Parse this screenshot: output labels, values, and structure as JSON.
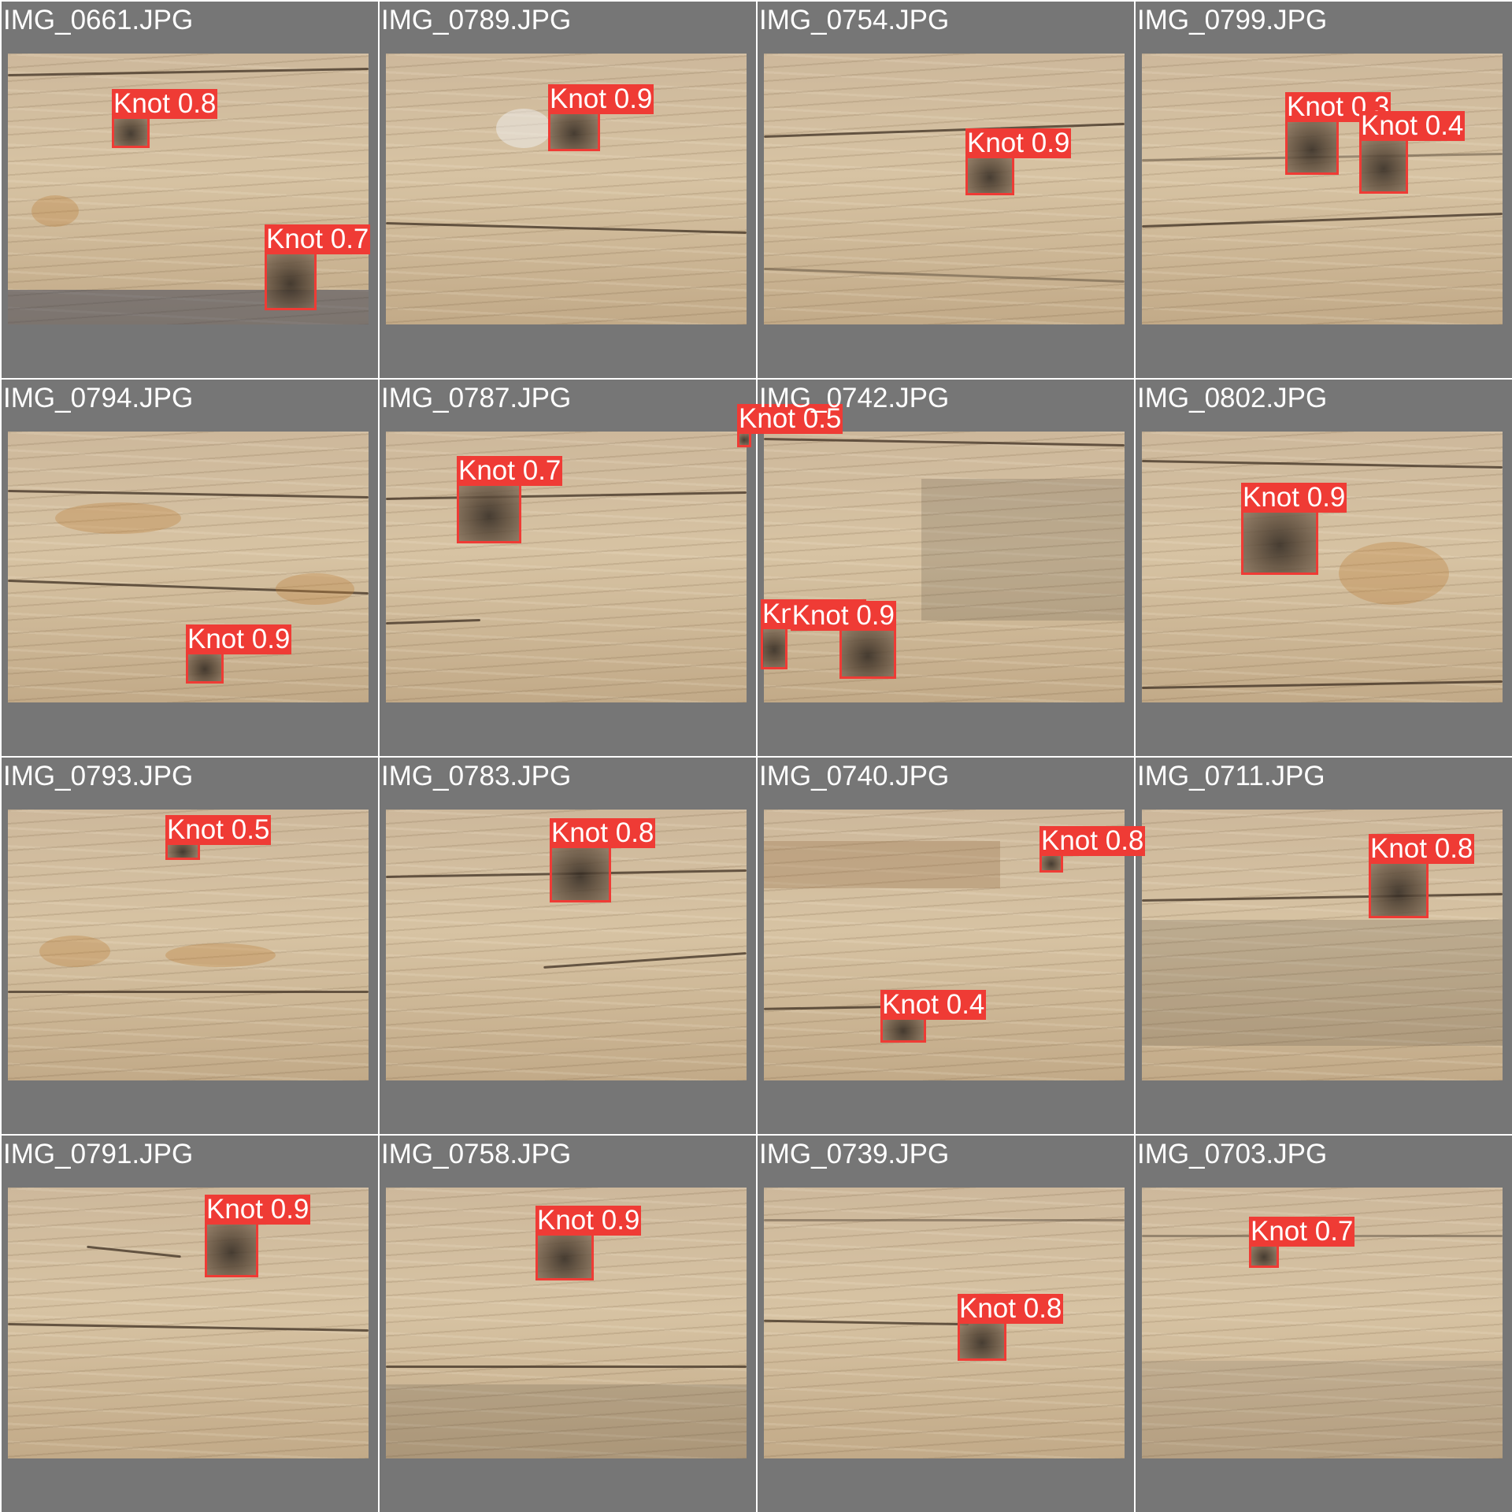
{
  "colors": {
    "tile_background": "#767676",
    "box_color": "#ef3b35",
    "label_text": "#ffffff"
  },
  "tiles": [
    {
      "filename": "IMG_0661.JPG",
      "detections": [
        {
          "label": "Knot 0.8"
        },
        {
          "label": "Knot 0.7"
        }
      ]
    },
    {
      "filename": "IMG_0789.JPG",
      "detections": [
        {
          "label": "Knot 0.9"
        }
      ]
    },
    {
      "filename": "IMG_0754.JPG",
      "detections": [
        {
          "label": "Knot 0.9"
        }
      ]
    },
    {
      "filename": "IMG_0799.JPG",
      "detections": [
        {
          "label": "Knot 0.3"
        },
        {
          "label": "Knot 0.4"
        }
      ]
    },
    {
      "filename": "IMG_0794.JPG",
      "detections": [
        {
          "label": "Knot 0.9"
        }
      ]
    },
    {
      "filename": "IMG_0787.JPG",
      "detections": [
        {
          "label": "Knot 0.7"
        },
        {
          "label": "Knot 0.5"
        }
      ]
    },
    {
      "filename": "IMG_0742.JPG",
      "detections": [
        {
          "label": "Knot 0.4"
        },
        {
          "label": "Knot 0.9"
        }
      ]
    },
    {
      "filename": "IMG_0802.JPG",
      "detections": [
        {
          "label": "Knot 0.9"
        }
      ]
    },
    {
      "filename": "IMG_0793.JPG",
      "detections": [
        {
          "label": "Knot 0.5"
        }
      ]
    },
    {
      "filename": "IMG_0783.JPG",
      "detections": [
        {
          "label": "Knot 0.8"
        }
      ]
    },
    {
      "filename": "IMG_0740.JPG",
      "detections": [
        {
          "label": "Knot 0.8"
        },
        {
          "label": "Knot 0.4"
        }
      ]
    },
    {
      "filename": "IMG_0711.JPG",
      "detections": [
        {
          "label": "Knot 0.8"
        }
      ]
    },
    {
      "filename": "IMG_0791.JPG",
      "detections": [
        {
          "label": "Knot 0.9"
        }
      ]
    },
    {
      "filename": "IMG_0758.JPG",
      "detections": [
        {
          "label": "Knot 0.9"
        }
      ]
    },
    {
      "filename": "IMG_0739.JPG",
      "detections": [
        {
          "label": "Knot 0.8"
        }
      ]
    },
    {
      "filename": "IMG_0703.JPG",
      "detections": [
        {
          "label": "Knot 0.7"
        }
      ]
    }
  ]
}
